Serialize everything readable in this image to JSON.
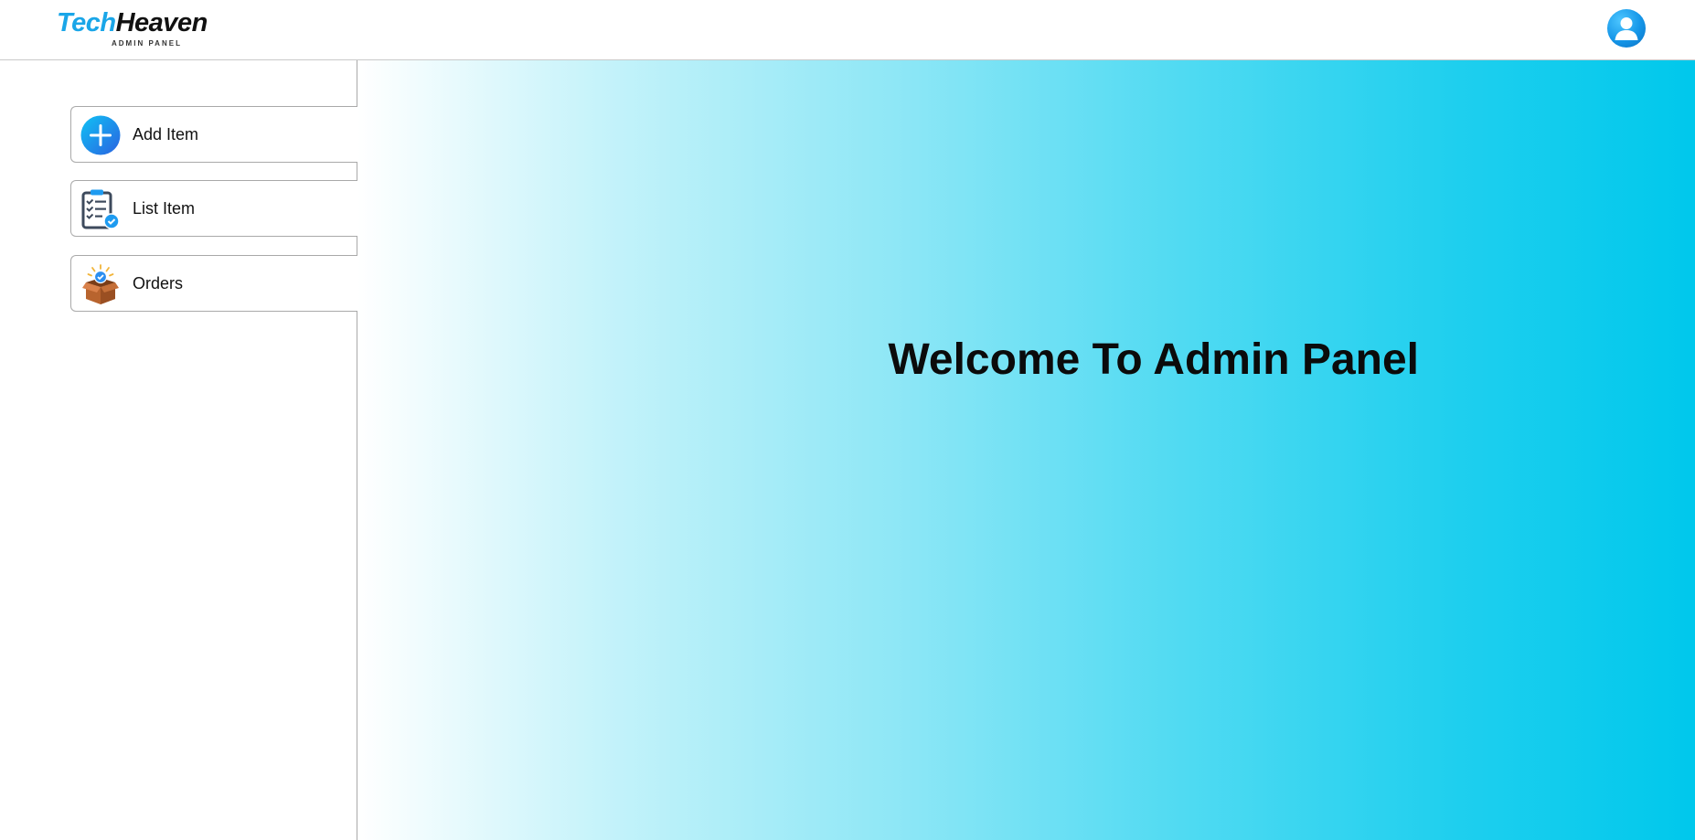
{
  "brand": {
    "name_part1": "Tech",
    "name_part2": "Heaven",
    "subtitle": "ADMIN PANEL",
    "accent_color": "#1aa6e8"
  },
  "header": {
    "avatar_icon": "user-avatar-icon"
  },
  "sidebar": {
    "items": [
      {
        "label": "Add Item",
        "icon": "add-icon"
      },
      {
        "label": "List Item",
        "icon": "checklist-icon"
      },
      {
        "label": "Orders",
        "icon": "package-box-icon"
      }
    ]
  },
  "main": {
    "welcome_text": "Welcome To Admin Panel",
    "gradient_start": "#ffffff",
    "gradient_end": "#00c8ec"
  }
}
